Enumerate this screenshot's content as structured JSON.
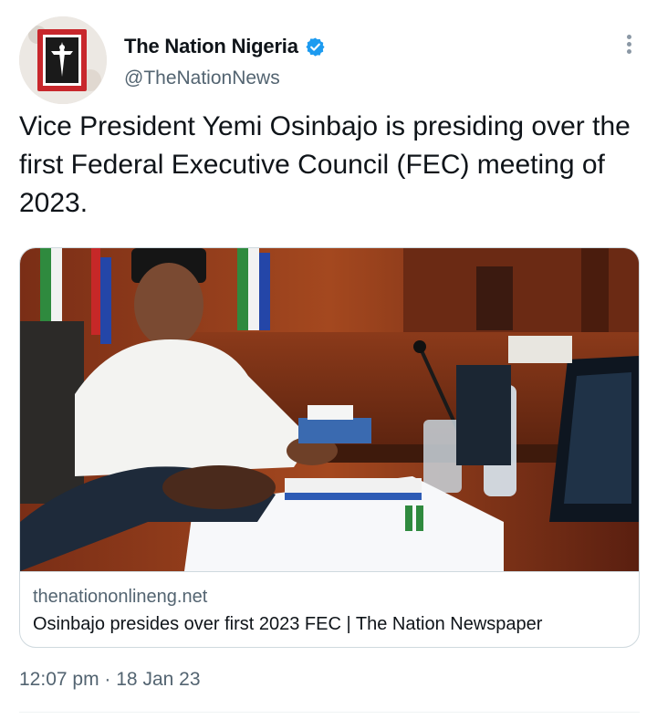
{
  "author": {
    "display_name": "The Nation Nigeria",
    "handle": "@TheNationNews",
    "verified": true,
    "verified_color": "#1d9bf0"
  },
  "tweet": {
    "text": "Vice President Yemi Osinbajo is presiding over the first Federal Executive Council (FEC) meeting of 2023."
  },
  "link_card": {
    "domain": "thenationonlineng.net",
    "title": "Osinbajo presides over first 2023 FEC | The Nation Newspaper",
    "image": "photo-vice-president-at-council-table"
  },
  "meta": {
    "time": "12:07 pm",
    "separator": "·",
    "date": "18 Jan 23"
  },
  "icons": {
    "more": "more-vertical-icon",
    "verified": "verified-badge-icon"
  },
  "colors": {
    "text_primary": "#0f1419",
    "text_secondary": "#536471",
    "border": "#cfd9de"
  }
}
